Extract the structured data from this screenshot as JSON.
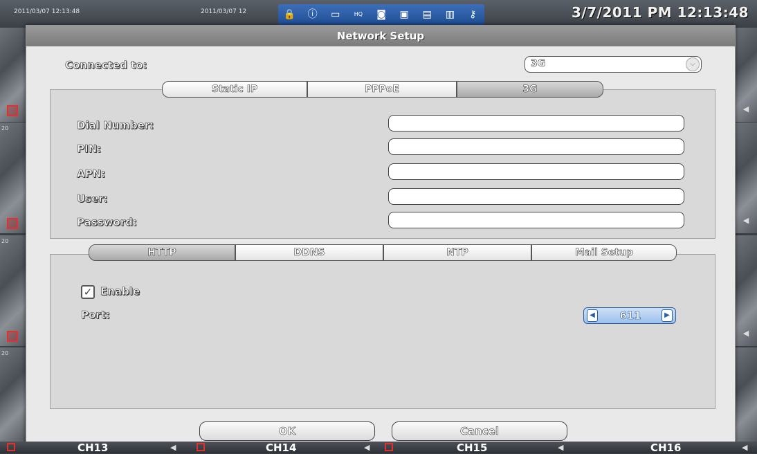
{
  "statusbar": {
    "timestamps": [
      "2011/03/07 12:13:48",
      "2011/03/07 12"
    ],
    "clock": "3/7/2011 PM 12:13:48",
    "icons": [
      "lock-icon",
      "info-icon",
      "tape-icon",
      "hq-icon",
      "camera-icon",
      "save-icon",
      "monitor-icon",
      "chart-icon",
      "key-icon"
    ]
  },
  "dialog": {
    "title": "Network Setup",
    "connected_label": "Connected to:",
    "connected_value": "3G",
    "connection_tabs": [
      "Static IP",
      "PPPoE",
      "3G"
    ],
    "active_connection_tab": "3G",
    "fields": [
      {
        "label": "Dial Number:",
        "value": ""
      },
      {
        "label": "PIN:",
        "value": ""
      },
      {
        "label": "APN:",
        "value": ""
      },
      {
        "label": "User:",
        "value": ""
      },
      {
        "label": "Password:",
        "value": ""
      }
    ],
    "service_tabs": [
      "HTTP",
      "DDNS",
      "NTP",
      "Mail Setup"
    ],
    "active_service_tab": "HTTP",
    "enable_label": "Enable",
    "enable_checked": true,
    "port_label": "Port:",
    "port_value": "611",
    "ok_label": "OK",
    "cancel_label": "Cancel"
  },
  "channels": [
    "CH13",
    "CH14",
    "CH15",
    "CH16"
  ],
  "tile_labels": [
    "20",
    "20",
    "20"
  ]
}
